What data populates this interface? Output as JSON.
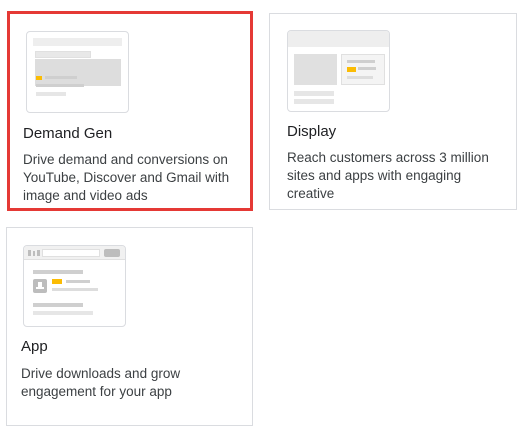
{
  "campaign_types": [
    {
      "id": "demand-gen",
      "title": "Demand Gen",
      "description": "Drive demand and conversions on YouTube, Discover and Gmail with image and video ads",
      "selected": true,
      "thumbnail_icon": "demand-gen-illustration-icon"
    },
    {
      "id": "display",
      "title": "Display",
      "description": "Reach customers across 3 million sites and apps with engaging creative",
      "selected": false,
      "thumbnail_icon": "display-illustration-icon"
    },
    {
      "id": "app",
      "title": "App",
      "description": "Drive downloads and grow engagement for your app",
      "selected": false,
      "thumbnail_icon": "app-illustration-icon"
    }
  ],
  "colors": {
    "selected_border": "#e53935",
    "card_border": "#dadce0",
    "accent_yellow": "#fbbc04",
    "placeholder_gray": "#e0e0e0",
    "placeholder_light": "#eeeeee",
    "title_text": "#202124",
    "desc_text": "#3c4043"
  }
}
